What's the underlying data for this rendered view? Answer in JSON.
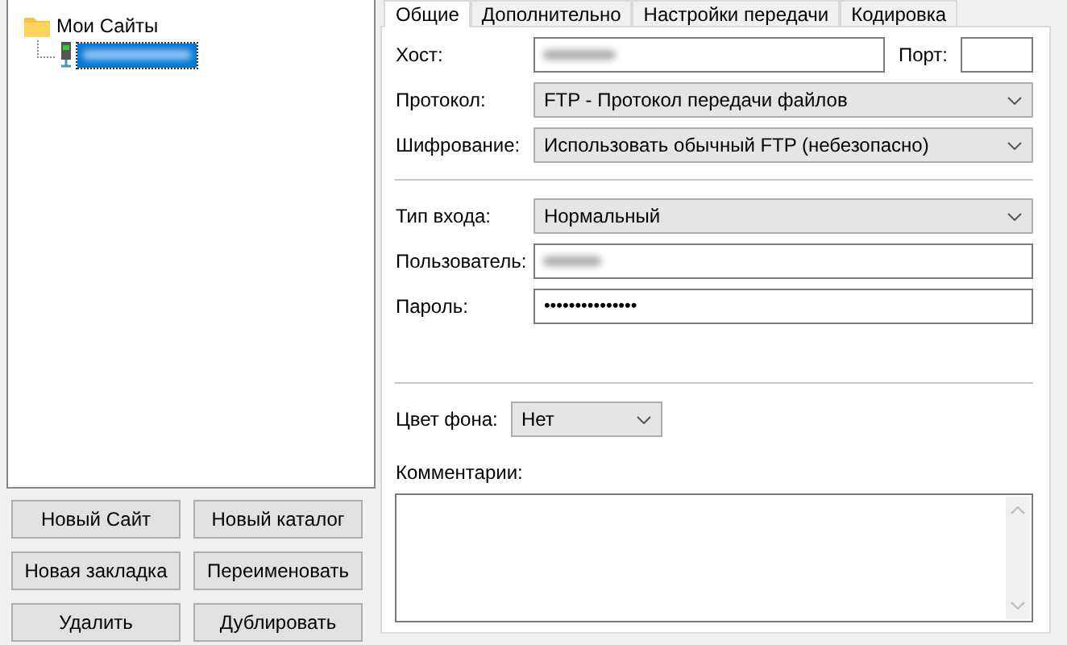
{
  "tree": {
    "root": {
      "label": "Мои Сайты",
      "children": [
        {
          "kind": "server",
          "selected": true,
          "redacted": true
        }
      ]
    }
  },
  "site_buttons": [
    "Новый Сайт",
    "Новый каталог",
    "Новая закладка",
    "Переименовать",
    "Удалить",
    "Дублировать"
  ],
  "tabs": [
    {
      "label": "Общие",
      "selected": true
    },
    {
      "label": "Дополнительно",
      "selected": false
    },
    {
      "label": "Настройки передачи",
      "selected": false
    },
    {
      "label": "Кодировка",
      "selected": false
    }
  ],
  "host": {
    "label": "Хост:",
    "redacted": true
  },
  "port": {
    "label": "Порт:"
  },
  "protocol": {
    "label": "Протокол:",
    "value": "FTP - Протокол передачи файлов"
  },
  "encryption": {
    "label": "Шифрование:",
    "value": "Использовать обычный FTP (небезопасно)"
  },
  "logon_type": {
    "label": "Тип входа:",
    "value": "Нормальный"
  },
  "user": {
    "label": "Пользователь:",
    "redacted": true
  },
  "password": {
    "label": "Пароль:",
    "value": "•••••••••••••••"
  },
  "background_color": {
    "label": "Цвет фона:",
    "value": "Нет"
  },
  "comments": {
    "label": "Комментарии:"
  }
}
